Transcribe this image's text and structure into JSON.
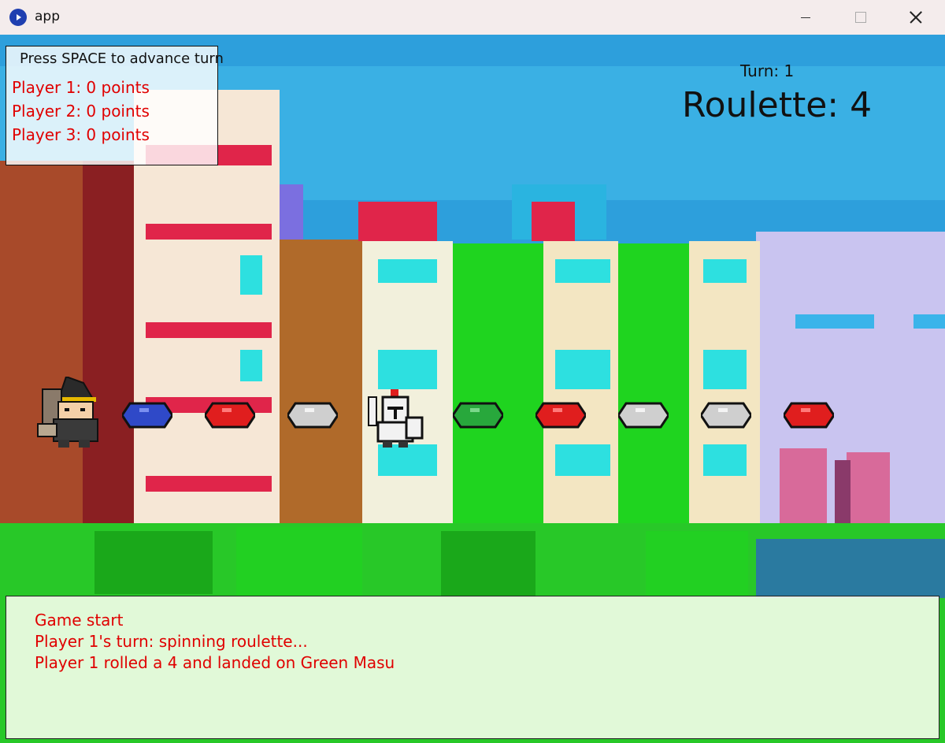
{
  "window": {
    "title": "app"
  },
  "hud": {
    "instruction": "Press SPACE to advance turn",
    "scores": [
      "Player 1: 0 points",
      "Player 2: 0 points",
      "Player 3: 0 points"
    ],
    "turn": "Turn: 1",
    "roulette": "Roulette: 4"
  },
  "board": {
    "spaces": [
      {
        "color": "#2f49c8",
        "icon": "blue-masu"
      },
      {
        "color": "#e01e1e",
        "icon": "red-masu"
      },
      {
        "color": "#cfcfcf",
        "icon": "gray-masu"
      },
      {
        "color": "#f2f2f2",
        "icon": "white-masu"
      },
      {
        "color": "#28a83c",
        "icon": "green-masu"
      },
      {
        "color": "#e01e1e",
        "icon": "red-masu"
      },
      {
        "color": "#cfcfcf",
        "icon": "gray-masu"
      },
      {
        "color": "#cfcfcf",
        "icon": "gray-masu"
      },
      {
        "color": "#e01e1e",
        "icon": "red-masu"
      }
    ]
  },
  "log": [
    "Game start",
    "Player 1's turn: spinning roulette...",
    "Player 1 rolled a 4 and landed on Green Masu"
  ]
}
